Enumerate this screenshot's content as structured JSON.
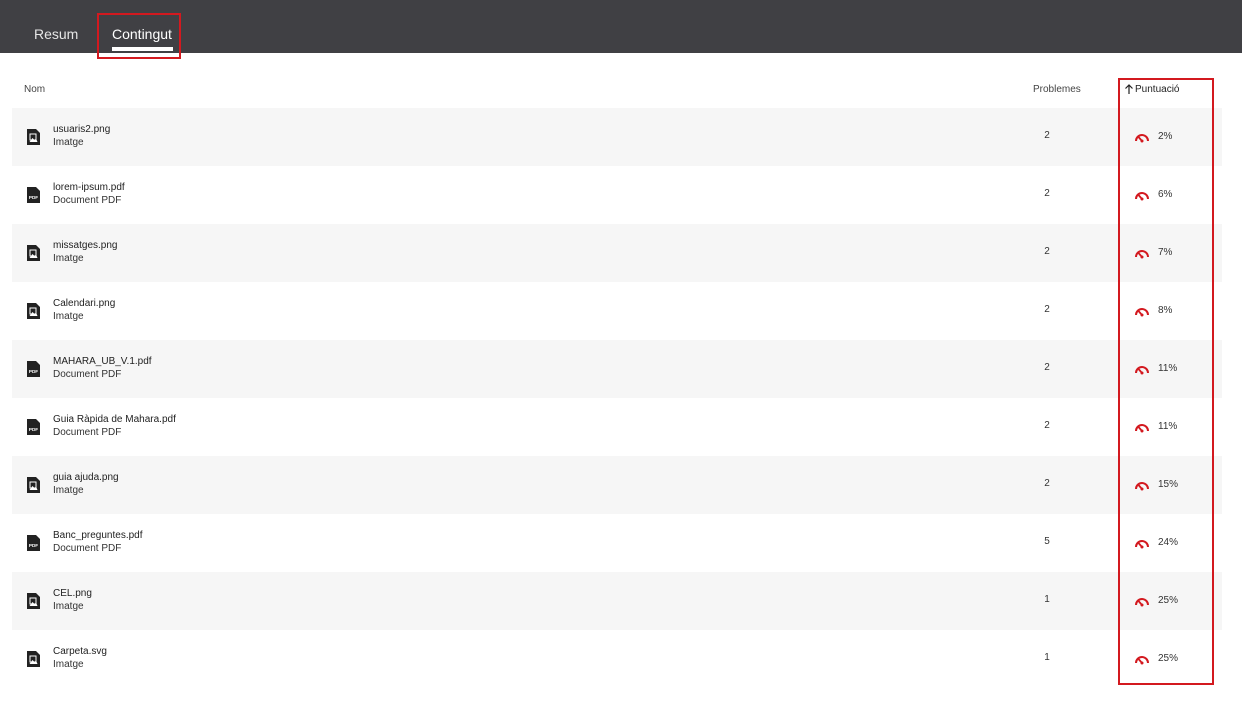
{
  "tabs": {
    "resum": "Resum",
    "contingut": "Contingut"
  },
  "columns": {
    "nom": "Nom",
    "problemes": "Problemes",
    "puntuacio": "Puntuació"
  },
  "colors": {
    "accent": "#d3191f",
    "topbar": "#404044"
  },
  "rows": [
    {
      "name": "usuaris2.png",
      "type": "Imatge",
      "icon": "image-file-icon",
      "problems": "2",
      "score": "2%"
    },
    {
      "name": "lorem-ipsum.pdf",
      "type": "Document PDF",
      "icon": "pdf-file-icon",
      "problems": "2",
      "score": "6%"
    },
    {
      "name": "missatges.png",
      "type": "Imatge",
      "icon": "image-file-icon",
      "problems": "2",
      "score": "7%"
    },
    {
      "name": "Calendari.png",
      "type": "Imatge",
      "icon": "image-file-icon",
      "problems": "2",
      "score": "8%"
    },
    {
      "name": "MAHARA_UB_V.1.pdf",
      "type": "Document PDF",
      "icon": "pdf-file-icon",
      "problems": "2",
      "score": "11%"
    },
    {
      "name": "Guia Ràpida de Mahara.pdf",
      "type": "Document PDF",
      "icon": "pdf-file-icon",
      "problems": "2",
      "score": "11%"
    },
    {
      "name": "guia ajuda.png",
      "type": "Imatge",
      "icon": "image-file-icon",
      "problems": "2",
      "score": "15%"
    },
    {
      "name": "Banc_preguntes.pdf",
      "type": "Document PDF",
      "icon": "pdf-file-icon",
      "problems": "5",
      "score": "24%"
    },
    {
      "name": "CEL.png",
      "type": "Imatge",
      "icon": "image-file-icon",
      "problems": "1",
      "score": "25%"
    },
    {
      "name": "Carpeta.svg",
      "type": "Imatge",
      "icon": "image-file-icon",
      "problems": "1",
      "score": "25%"
    }
  ]
}
